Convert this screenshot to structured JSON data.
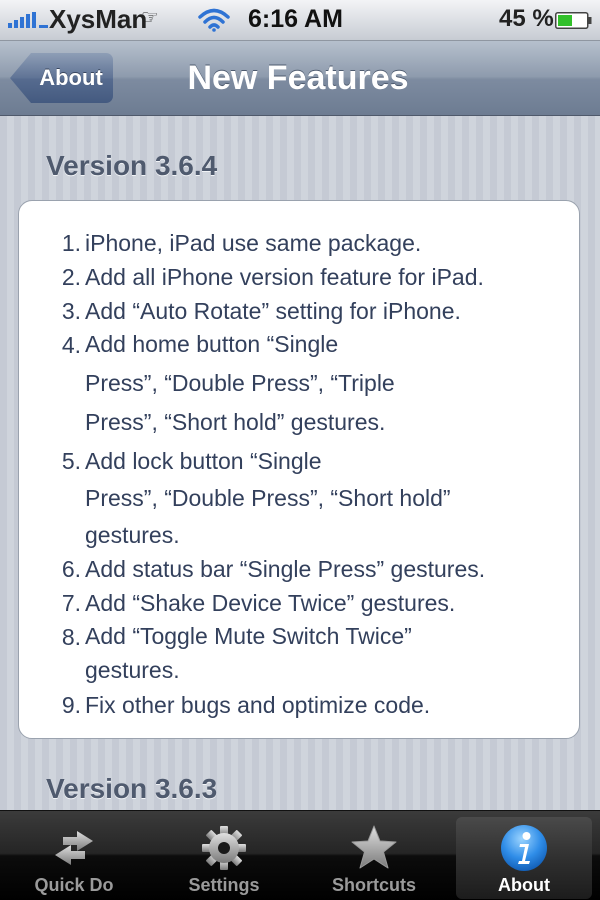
{
  "status_bar": {
    "carrier": "XysMan",
    "time": "6:16 AM",
    "battery": "45 %",
    "glyph_1": "☞",
    "glyph_2": "",
    "signal_icon": "signal-bars-icon",
    "wifi_icon": "wifi-icon",
    "battery_icon": "battery-icon"
  },
  "nav": {
    "back_label": "About",
    "title": "New Features"
  },
  "content": {
    "sections": [
      {
        "heading": "Version 3.6.4",
        "items": [
          {
            "num": "1.",
            "text": "iPhone, iPad use same package."
          },
          {
            "num": "2.",
            "text": "Add all iPhone version feature for iPad."
          },
          {
            "num": "3.",
            "text": "Add “Auto Rotate” setting for iPhone."
          },
          {
            "num": "4.",
            "text": "Add home button “Single\nPress”,  “Double Press”,  “Triple\nPress”,  “Short hold” gestures."
          },
          {
            "num": "5.",
            "text": "Add lock button “Single\nPress”,  “Double Press”,  “Short hold”\ngestures."
          },
          {
            "num": "6.",
            "text": "Add status bar “Single Press” gestures."
          },
          {
            "num": "7.",
            "text": "Add “Shake Device Twice” gestures."
          },
          {
            "num": "8.",
            "text": "Add “Toggle Mute Switch Twice”\ngestures."
          },
          {
            "num": "9.",
            "text": "Fix other bugs and optimize code."
          }
        ]
      },
      {
        "heading": "Version 3.6.3"
      }
    ]
  },
  "tabs": [
    {
      "label": "Quick Do",
      "icon": "arrows-icon",
      "selected": false
    },
    {
      "label": "Settings",
      "icon": "gear-icon",
      "selected": false
    },
    {
      "label": "Shortcuts",
      "icon": "star-icon",
      "selected": false
    },
    {
      "label": "About",
      "icon": "info-icon",
      "selected": true
    }
  ],
  "colors": {
    "nav_bar": "#8e9bad",
    "back_button": "#566b8f",
    "heading_text": "#4f5a6e",
    "list_text": "#33405c",
    "tab_bar": "#000000",
    "tab_selected_icon": "#2f8de8",
    "battery_fill": "#32c02b"
  }
}
